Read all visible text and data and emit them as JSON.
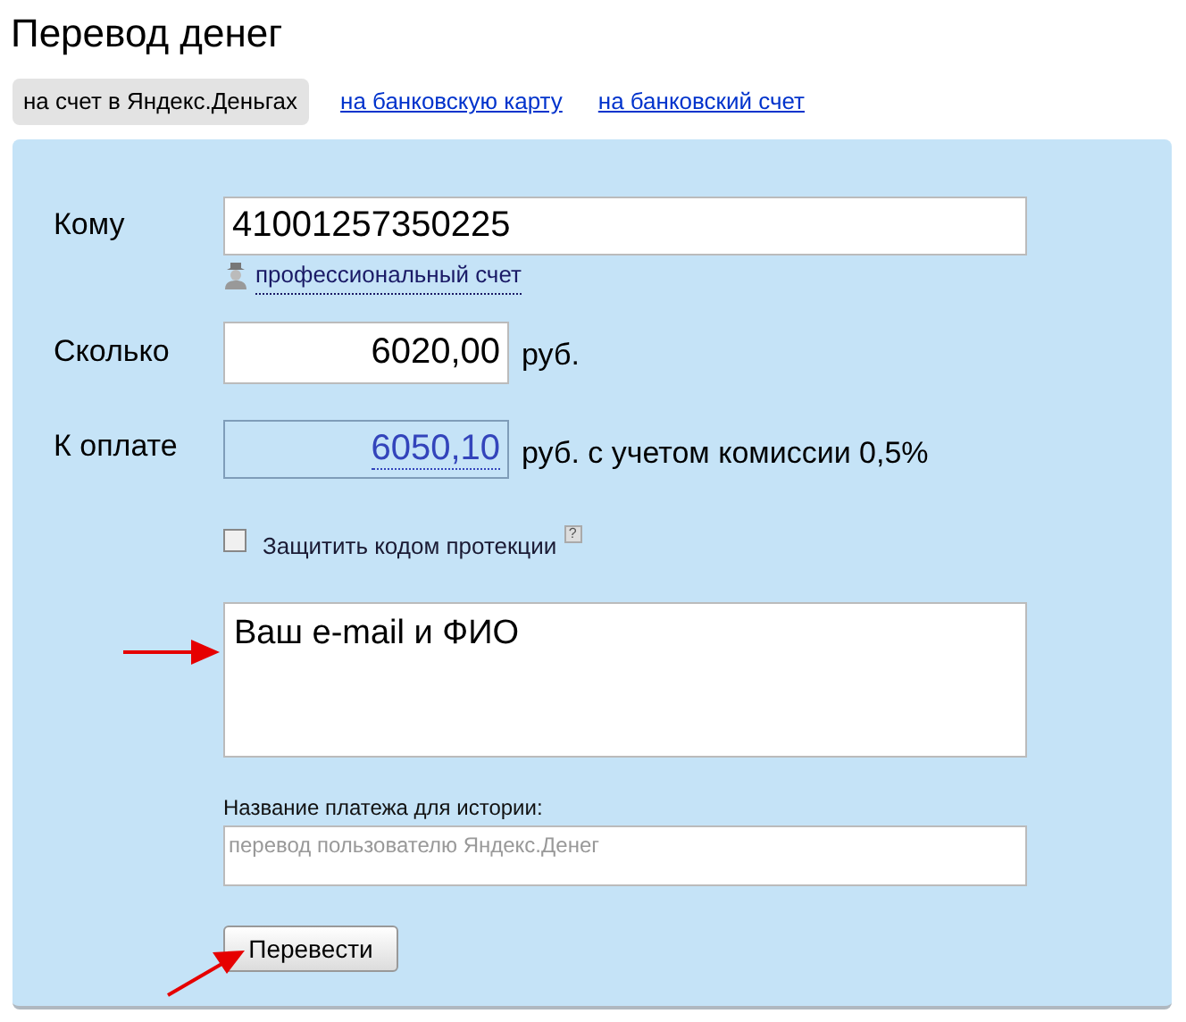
{
  "title": "Перевод денег",
  "tabs": [
    {
      "label": "на счет в Яндекс.Деньгах",
      "selected": true
    },
    {
      "label": "на банковскую карту",
      "selected": false
    },
    {
      "label": "на банковский счет",
      "selected": false
    }
  ],
  "recipient": {
    "label": "Кому",
    "value": "41001257350225",
    "link": "профессиональный счет"
  },
  "amount": {
    "label": "Сколько",
    "value": "6020,00",
    "unit": "руб."
  },
  "total": {
    "label": "К оплате",
    "value": "6050,10",
    "note": "руб. с учетом комиссии 0,5%"
  },
  "protection": {
    "label": "Защитить кодом протекции",
    "checked": false,
    "help": "?"
  },
  "message": {
    "value": "Ваш e-mail и ФИО"
  },
  "history": {
    "label": "Название платежа для истории:",
    "placeholder": "перевод пользователю Яндекс.Денег"
  },
  "submit": "Перевести"
}
